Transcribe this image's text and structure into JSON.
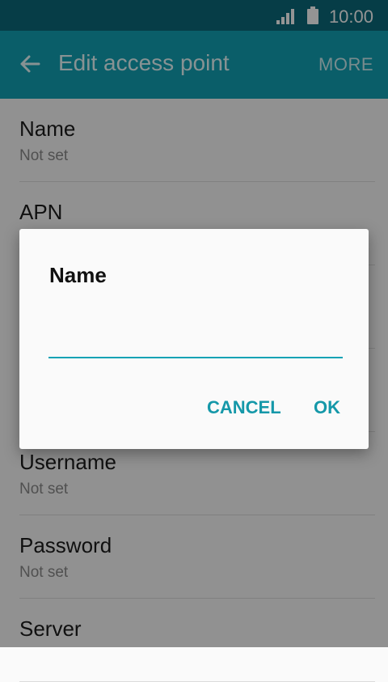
{
  "status_bar": {
    "time": "10:00",
    "signal_icon": "signal-icon",
    "battery_icon": "battery-icon"
  },
  "app_bar": {
    "title": "Edit access point",
    "more_label": "MORE",
    "back_icon": "back-arrow-icon"
  },
  "settings": [
    {
      "title": "Name",
      "subtitle": "Not set"
    },
    {
      "title": "APN",
      "subtitle": ""
    },
    {
      "title": "",
      "subtitle": ""
    },
    {
      "title": "",
      "subtitle": ""
    },
    {
      "title": "Username",
      "subtitle": "Not set"
    },
    {
      "title": "Password",
      "subtitle": "Not set"
    },
    {
      "title": "Server",
      "subtitle": ""
    }
  ],
  "dialog": {
    "title": "Name",
    "input_value": "",
    "cancel_label": "CANCEL",
    "ok_label": "OK"
  },
  "colors": {
    "status_bar": "#0b6a7a",
    "app_bar": "#12a3b5",
    "accent": "#1598a9"
  }
}
